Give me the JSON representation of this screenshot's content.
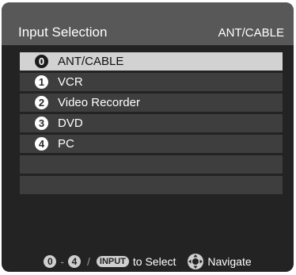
{
  "header": {
    "title": "Input Selection",
    "current_source": "ANT/CABLE"
  },
  "inputs": [
    {
      "number": "0",
      "label": "ANT/CABLE",
      "selected": true
    },
    {
      "number": "1",
      "label": "VCR",
      "selected": false
    },
    {
      "number": "2",
      "label": "Video Recorder",
      "selected": false
    },
    {
      "number": "3",
      "label": "DVD",
      "selected": false
    },
    {
      "number": "4",
      "label": "PC",
      "selected": false
    }
  ],
  "empty_rows": 2,
  "footer": {
    "range_start": "0",
    "range_dash": "-",
    "range_end": "4",
    "separator": "/",
    "input_key": "INPUT",
    "select_text": "to Select",
    "navigate_text": "Navigate",
    "navigate_icon": "dpad-icon"
  },
  "colors": {
    "panel_bg": "#232323",
    "header_bg": "#585858",
    "row_bg": "#3e3e3e",
    "selected_row_bg": "#d2d2d2"
  }
}
